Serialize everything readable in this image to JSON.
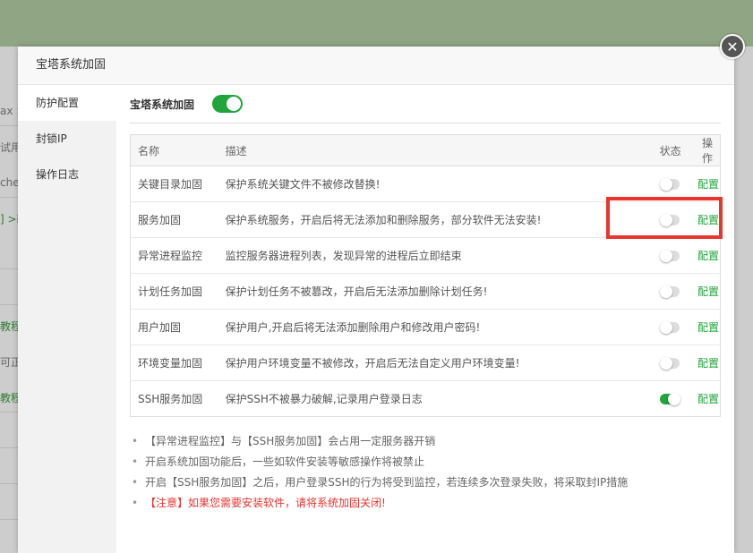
{
  "background": {
    "fragments": [
      "ax >",
      "试用",
      "che",
      "] >新",
      "教程",
      "可正常",
      "教程"
    ]
  },
  "dialog": {
    "title": "宝塔系统加固",
    "close_symbol": "✕"
  },
  "sidebar": {
    "items": [
      {
        "label": "防护配置"
      },
      {
        "label": "封锁IP"
      },
      {
        "label": "操作日志"
      }
    ]
  },
  "main": {
    "switch_label": "宝塔系统加固",
    "switch_on": true,
    "table": {
      "headers": {
        "name": "名称",
        "desc": "描述",
        "status": "状态",
        "op": "操作"
      },
      "rows": [
        {
          "name": "关键目录加固",
          "desc": "保护系统关键文件不被修改替换!",
          "enabled": false,
          "op": "配置"
        },
        {
          "name": "服务加固",
          "desc": "保护系统服务，开启后将无法添加和删除服务，部分软件无法安装!",
          "enabled": false,
          "op": "配置"
        },
        {
          "name": "异常进程监控",
          "desc": "监控服务器进程列表，发现异常的进程后立即结束",
          "enabled": false,
          "op": "配置"
        },
        {
          "name": "计划任务加固",
          "desc": "保护计划任务不被篡改，开启后无法添加删除计划任务!",
          "enabled": false,
          "op": "配置"
        },
        {
          "name": "用户加固",
          "desc": "保护用户,开启后将无法添加删除用户和修改用户密码!",
          "enabled": false,
          "op": "配置"
        },
        {
          "name": "环境变量加固",
          "desc": "保护用户环境变量不被修改，开启后无法自定义用户环境变量!",
          "enabled": false,
          "op": "配置"
        },
        {
          "name": "SSH服务加固",
          "desc": "保护SSH不被暴力破解,记录用户登录日志",
          "enabled": true,
          "op": "配置"
        }
      ]
    },
    "notes": [
      "【异常进程监控】与【SSH服务加固】会占用一定服务器开销",
      "开启系统加固功能后，一些如软件安装等敏感操作将被禁止",
      "开启【SSH服务加固】之后，用户登录SSH的行为将受到监控，若连续多次登录失败，将采取封IP措施"
    ],
    "warning": "【注意】如果您需要安装软件，请将系统加固关闭!"
  },
  "colors": {
    "accent": "#20a53a",
    "warning": "#e8352f",
    "highlight_box": "#e8352f"
  }
}
